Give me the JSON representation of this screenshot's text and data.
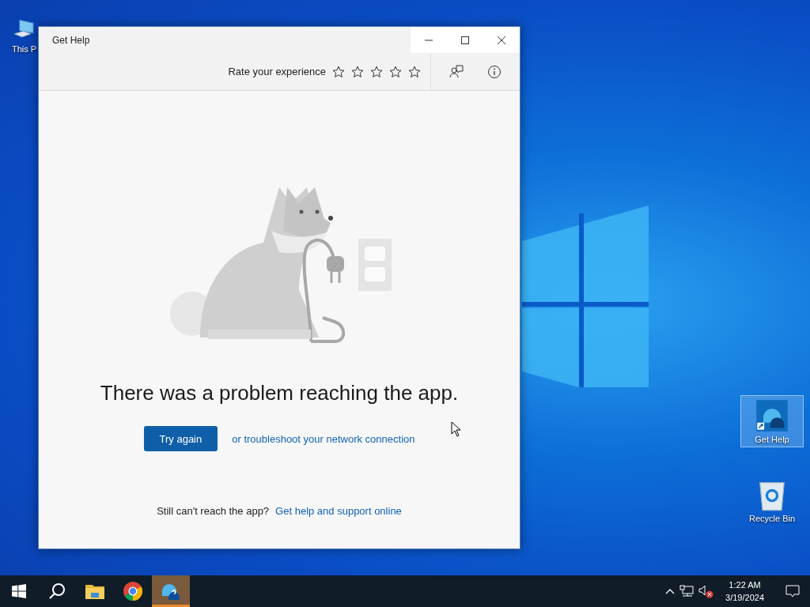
{
  "desktop_icons": [
    {
      "kind": "computer",
      "label": "This P",
      "selected": false
    },
    {
      "kind": "help",
      "label": "Get Help",
      "selected": true
    },
    {
      "kind": "bin",
      "label": "Recycle Bin",
      "selected": false
    }
  ],
  "window": {
    "title": "Get Help",
    "toolbar": {
      "rate_label": "Rate your experience",
      "stars": 0
    },
    "heading": "There was a problem reaching the app.",
    "try_again_button": "Try again",
    "troubleshoot_link": "or troubleshoot your network connection",
    "footer_text": "Still can't reach the app?",
    "footer_link": "Get help and support online"
  },
  "taskbar": {
    "apps": [
      {
        "kind": "start",
        "active": false
      },
      {
        "kind": "search",
        "active": false
      },
      {
        "kind": "folder",
        "active": false
      },
      {
        "kind": "browser",
        "active": false
      },
      {
        "kind": "help",
        "active": true
      }
    ],
    "time": "1:22 AM",
    "date": "3/19/2024"
  }
}
